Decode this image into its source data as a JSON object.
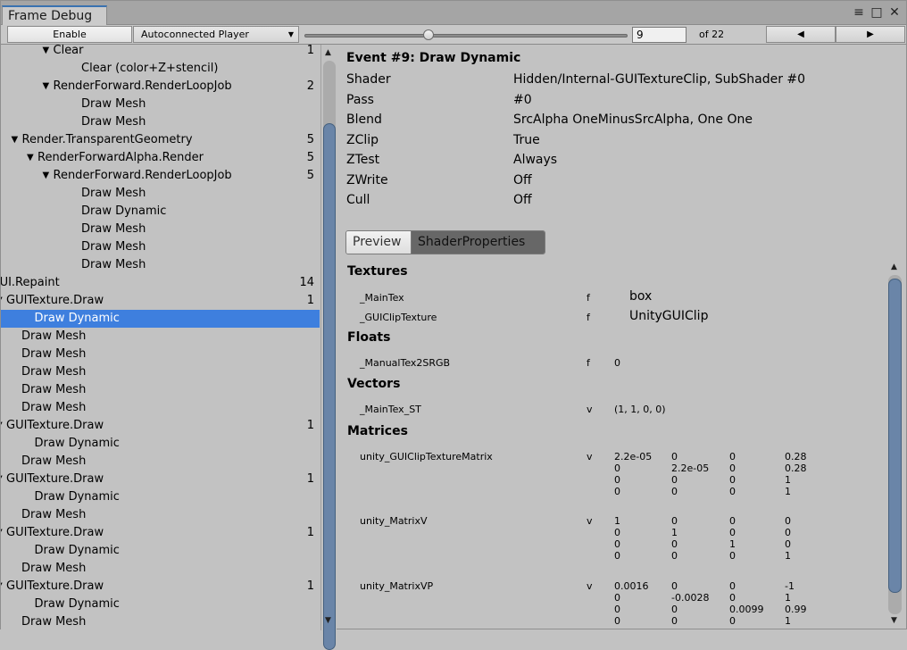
{
  "window": {
    "title": "Frame Debug",
    "controls": [
      "≡",
      "□",
      "✕"
    ]
  },
  "toolbar": {
    "enable_label": "Enable",
    "player": "Autoconnected Player",
    "event_value": "9",
    "of_label": "of 22",
    "prev": "◀",
    "next": "▶",
    "slider_fraction": 0.38
  },
  "tree": [
    {
      "label": "Clear",
      "count": "1",
      "indent": 1,
      "arrow": true
    },
    {
      "label": "Clear (color+Z+stencil)",
      "count": "",
      "indent": 2,
      "arrow": false
    },
    {
      "label": "RenderForward.RenderLoopJob",
      "count": "2",
      "indent": 1,
      "arrow": true
    },
    {
      "label": "Draw Mesh",
      "count": "",
      "indent": 2,
      "arrow": false
    },
    {
      "label": "Draw Mesh",
      "count": "",
      "indent": 2,
      "arrow": false
    },
    {
      "label": "Render.TransparentGeometry",
      "count": "5",
      "indent": -1,
      "arrow": true
    },
    {
      "label": "RenderForwardAlpha.Render",
      "count": "5",
      "indent": 0,
      "arrow": true
    },
    {
      "label": "RenderForward.RenderLoopJob",
      "count": "5",
      "indent": 1,
      "arrow": true
    },
    {
      "label": "Draw Mesh",
      "count": "",
      "indent": 2,
      "arrow": false
    },
    {
      "label": "Draw Dynamic",
      "count": "",
      "indent": 2,
      "arrow": false
    },
    {
      "label": "Draw Mesh",
      "count": "",
      "indent": 2,
      "arrow": false
    },
    {
      "label": "Draw Mesh",
      "count": "",
      "indent": 2,
      "arrow": false
    },
    {
      "label": "Draw Mesh",
      "count": "",
      "indent": 2,
      "arrow": false
    },
    {
      "label": "GUI.Repaint",
      "count": "14",
      "indent": -3,
      "arrow": true
    },
    {
      "label": "GUITexture.Draw",
      "count": "1",
      "indent": -2,
      "arrow": true
    },
    {
      "label": "Draw Dynamic",
      "count": "",
      "indent": -1,
      "arrow": false,
      "selected": true
    },
    {
      "label": "Draw Mesh",
      "count": "",
      "indent": -2,
      "arrow": false
    },
    {
      "label": "Draw Mesh",
      "count": "",
      "indent": -2,
      "arrow": false
    },
    {
      "label": "Draw Mesh",
      "count": "",
      "indent": -2,
      "arrow": false
    },
    {
      "label": "Draw Mesh",
      "count": "",
      "indent": -2,
      "arrow": false
    },
    {
      "label": "Draw Mesh",
      "count": "",
      "indent": -2,
      "arrow": false
    },
    {
      "label": "GUITexture.Draw",
      "count": "1",
      "indent": -2,
      "arrow": true
    },
    {
      "label": "Draw Dynamic",
      "count": "",
      "indent": -1,
      "arrow": false
    },
    {
      "label": "Draw Mesh",
      "count": "",
      "indent": -2,
      "arrow": false
    },
    {
      "label": "GUITexture.Draw",
      "count": "1",
      "indent": -2,
      "arrow": true
    },
    {
      "label": "Draw Dynamic",
      "count": "",
      "indent": -1,
      "arrow": false
    },
    {
      "label": "Draw Mesh",
      "count": "",
      "indent": -2,
      "arrow": false
    },
    {
      "label": "GUITexture.Draw",
      "count": "1",
      "indent": -2,
      "arrow": true
    },
    {
      "label": "Draw Dynamic",
      "count": "",
      "indent": -1,
      "arrow": false
    },
    {
      "label": "Draw Mesh",
      "count": "",
      "indent": -2,
      "arrow": false
    },
    {
      "label": "GUITexture.Draw",
      "count": "1",
      "indent": -2,
      "arrow": true
    },
    {
      "label": "Draw Dynamic",
      "count": "",
      "indent": -1,
      "arrow": false
    },
    {
      "label": "Draw Mesh",
      "count": "",
      "indent": -2,
      "arrow": false
    }
  ],
  "details": {
    "title": "Event #9: Draw Dynamic",
    "properties": [
      {
        "key": "Shader",
        "value": "Hidden/Internal-GUITextureClip, SubShader #0"
      },
      {
        "key": "Pass",
        "value": "#0"
      },
      {
        "key": "Blend",
        "value": "SrcAlpha OneMinusSrcAlpha, One One"
      },
      {
        "key": "ZClip",
        "value": "True"
      },
      {
        "key": "ZTest",
        "value": "Always"
      },
      {
        "key": "ZWrite",
        "value": "Off"
      },
      {
        "key": "Cull",
        "value": "Off"
      }
    ],
    "tabs": [
      "Preview",
      "ShaderProperties"
    ],
    "active_tab": "ShaderProperties"
  },
  "shader_properties": {
    "textures_heading": "Textures",
    "textures": [
      {
        "name": "_MainTex",
        "type": "f",
        "value": "box"
      },
      {
        "name": "_GUIClipTexture",
        "type": "f",
        "value": "UnityGUIClip"
      }
    ],
    "floats_heading": "Floats",
    "floats": [
      {
        "name": "_ManualTex2SRGB",
        "type": "f",
        "value": "0"
      }
    ],
    "vectors_heading": "Vectors",
    "vectors": [
      {
        "name": "_MainTex_ST",
        "type": "v",
        "value": "(1, 1, 0, 0)"
      }
    ],
    "matrices_heading": "Matrices",
    "matrices": [
      {
        "name": "unity_GUIClipTextureMatrix",
        "type": "v",
        "rows": [
          [
            "2.2e-05",
            "0",
            "0",
            "0.28"
          ],
          [
            "0",
            "2.2e-05",
            "0",
            "0.28"
          ],
          [
            "0",
            "0",
            "0",
            "1"
          ],
          [
            "0",
            "0",
            "0",
            "1"
          ]
        ]
      },
      {
        "name": "unity_MatrixV",
        "type": "v",
        "rows": [
          [
            "1",
            "0",
            "0",
            "0"
          ],
          [
            "0",
            "1",
            "0",
            "0"
          ],
          [
            "0",
            "0",
            "1",
            "0"
          ],
          [
            "0",
            "0",
            "0",
            "1"
          ]
        ]
      },
      {
        "name": "unity_MatrixVP",
        "type": "v",
        "rows": [
          [
            "0.0016",
            "0",
            "0",
            "-1"
          ],
          [
            "0",
            "-0.0028",
            "0",
            "1"
          ],
          [
            "0",
            "0",
            "0.0099",
            "0.99"
          ],
          [
            "0",
            "0",
            "0",
            "1"
          ]
        ]
      }
    ]
  }
}
